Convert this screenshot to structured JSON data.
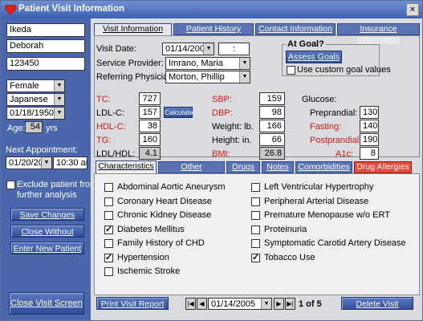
{
  "window": {
    "title": "Patient Visit Information",
    "close_icon": "×"
  },
  "patient": {
    "last_name": "Ikeda",
    "first_name": "Deborah",
    "id": "123450",
    "gender": "Female",
    "ethnicity": "Japanese",
    "dob": "01/18/1950",
    "age_label": "Age:",
    "age": "54",
    "age_unit": "yrs",
    "next_appt_label": "Next Appointment:",
    "next_appt_date": "01/20/2005",
    "next_appt_time": "10:30 am",
    "exclude_label_1": "Exclude patient from",
    "exclude_label_2": "further analysis",
    "exclude_checked": false
  },
  "left_buttons": {
    "save": "Save Changes",
    "close_no_save": "Close Without Saving",
    "enter_new": "Enter New Patient",
    "close_visit": "Close Visit Screen"
  },
  "tabs": [
    {
      "label": "Visit Information",
      "active": true
    },
    {
      "label": "Patient History",
      "active": false
    },
    {
      "label": "Contact Information",
      "active": false
    },
    {
      "label": "Insurance Information",
      "active": false
    }
  ],
  "visit": {
    "date_label": "Visit Date:",
    "date": "01/14/2005",
    "time": " : ",
    "provider_label": "Service Provider:",
    "provider": "Imrano, Maria",
    "referring_label": "Referring Physician:",
    "referring": "Morton, Phillip",
    "at_goal_label": "At Goal?",
    "assess_btn": "Assess Goals",
    "custom_goal_label": "Use custom goal values",
    "custom_goal_checked": false
  },
  "labs": {
    "tc_label": "TC:",
    "tc": "727",
    "ldl_label": "LDL-C:",
    "ldl": "157",
    "calc_btn": "Calculate",
    "hdl_label": "HDL-C:",
    "hdl": "38",
    "tg_label": "TG:",
    "tg": "160",
    "ldlhdl_label": "LDL/HDL:",
    "ldlhdl": "4.1",
    "sbp_label": "SBP:",
    "sbp": "159",
    "dbp_label": "DBP:",
    "dbp": "98",
    "weight_label": "Weight: lb.",
    "weight": "166",
    "height_label": "Height:  in.",
    "height": "66",
    "bmi_label": "BMI:",
    "bmi": "26.8",
    "glucose_label": "Glucose:",
    "preprandial_label": "Preprandial:",
    "preprandial": "130",
    "fasting_label": "Fasting:",
    "fasting": "140",
    "postprandial_label": "Postprandial:",
    "postprandial": "190",
    "a1c_label": "A1c:",
    "a1c": "8"
  },
  "subtabs": [
    {
      "label": "Characteristics",
      "active": true
    },
    {
      "label": "Other Parameters",
      "active": false
    },
    {
      "label": "Drugs",
      "active": false
    },
    {
      "label": "Notes",
      "active": false
    },
    {
      "label": "Comorbidities",
      "active": false
    },
    {
      "label": "Drug Allergies",
      "active": false
    }
  ],
  "characteristics_left": [
    {
      "label": "Abdominal Aortic Aneurysm",
      "checked": false
    },
    {
      "label": "Coronary Heart Disease",
      "checked": false
    },
    {
      "label": "Chronic Kidney Disease",
      "checked": false
    },
    {
      "label": "Diabetes Mellitus",
      "checked": true
    },
    {
      "label": "Family History of CHD",
      "checked": false
    },
    {
      "label": "Hypertension",
      "checked": true
    },
    {
      "label": "Ischemic Stroke",
      "checked": false
    }
  ],
  "characteristics_right": [
    {
      "label": "Left Ventricular Hypertrophy",
      "checked": false
    },
    {
      "label": "Peripheral Arterial Disease",
      "checked": false
    },
    {
      "label": "Premature Menopause w/o ERT",
      "checked": false
    },
    {
      "label": "Proteinuria",
      "checked": false
    },
    {
      "label": "Symptomatic Carotid Artery Disease",
      "checked": false
    },
    {
      "label": "Tobacco Use",
      "checked": true
    }
  ],
  "footer": {
    "print_btn": "Print Visit Report",
    "nav_first": "|◀",
    "nav_prev": "◀",
    "nav_date": "01/14/2005",
    "nav_next": "▶",
    "nav_last": "▶|",
    "record_count": "1 of 5",
    "delete_btn": "Delete Visit"
  }
}
